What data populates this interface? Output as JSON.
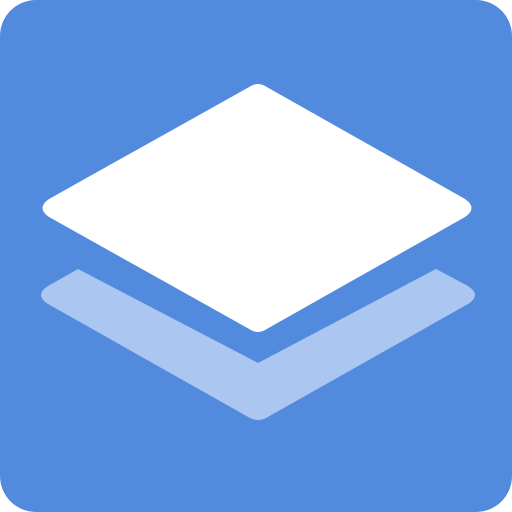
{
  "icon": {
    "name": "layers-icon",
    "colors": {
      "background": "#528BDE",
      "top_layer": "#FFFFFF",
      "bottom_layer": "#ABC6F0"
    }
  }
}
